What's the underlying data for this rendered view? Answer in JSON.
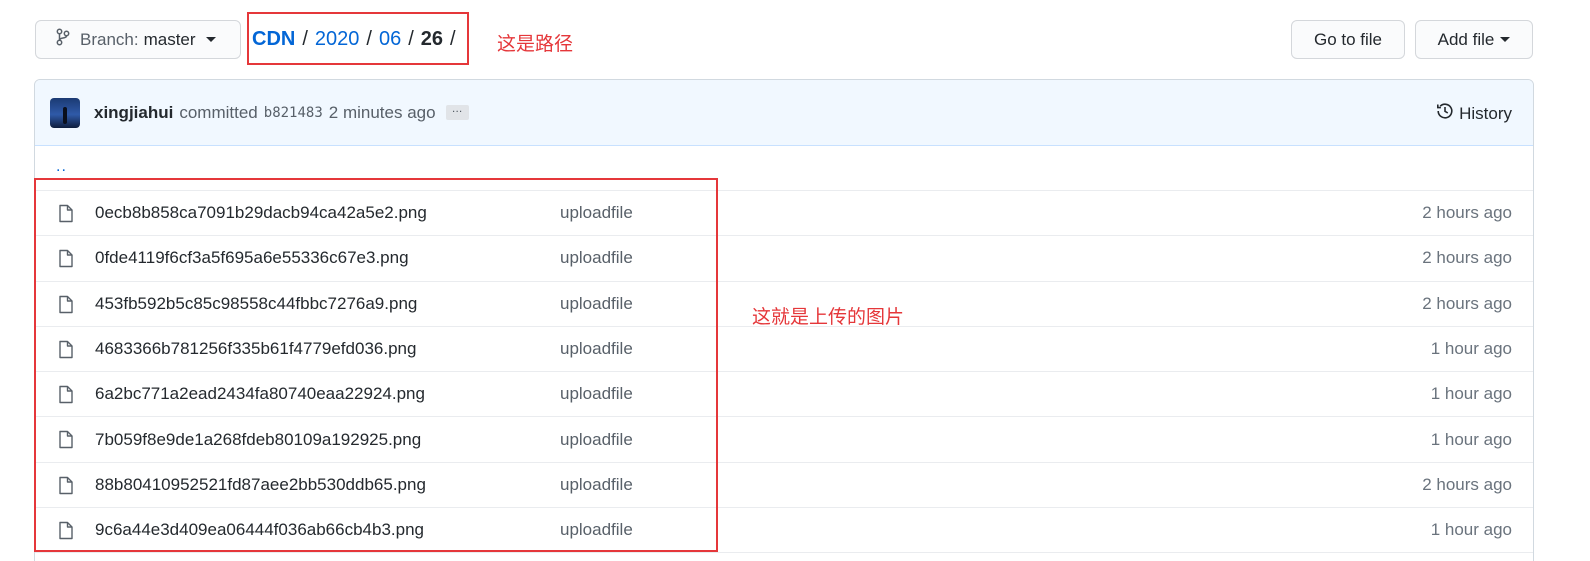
{
  "toolbar": {
    "branch_label": "Branch:",
    "branch_value": "master",
    "go_to_file": "Go to file",
    "add_file": "Add file"
  },
  "breadcrumb": {
    "items": [
      "CDN",
      "2020",
      "06",
      "26"
    ],
    "separator": "/"
  },
  "annotations": {
    "path_note": "这是路径",
    "files_note": "这就是上传的图片",
    "color": "#e5373a"
  },
  "commit": {
    "author": "xingjiahui",
    "verb": "committed",
    "sha": "b821483",
    "time": "2 minutes ago",
    "more": "…",
    "history_label": "History"
  },
  "parent_link": "..",
  "files": [
    {
      "name": "0ecb8b858ca7091b29dacb94ca42a5e2.png",
      "message": "uploadfile",
      "age": "2 hours ago"
    },
    {
      "name": "0fde4119f6cf3a5f695a6e55336c67e3.png",
      "message": "uploadfile",
      "age": "2 hours ago"
    },
    {
      "name": "453fb592b5c85c98558c44fbbc7276a9.png",
      "message": "uploadfile",
      "age": "2 hours ago"
    },
    {
      "name": "4683366b781256f335b61f4779efd036.png",
      "message": "uploadfile",
      "age": "1 hour ago"
    },
    {
      "name": "6a2bc771a2ead2434fa80740eaa22924.png",
      "message": "uploadfile",
      "age": "1 hour ago"
    },
    {
      "name": "7b059f8e9de1a268fdeb80109a192925.png",
      "message": "uploadfile",
      "age": "1 hour ago"
    },
    {
      "name": "88b80410952521fd87aee2bb530ddb65.png",
      "message": "uploadfile",
      "age": "2 hours ago"
    },
    {
      "name": "9c6a44e3d409ea06444f036ab66cb4b3.png",
      "message": "uploadfile",
      "age": "1 hour ago"
    }
  ],
  "colors": {
    "link": "#0366d6",
    "text": "#24292e",
    "muted": "#586069",
    "commit_bg": "#f1f8ff"
  }
}
